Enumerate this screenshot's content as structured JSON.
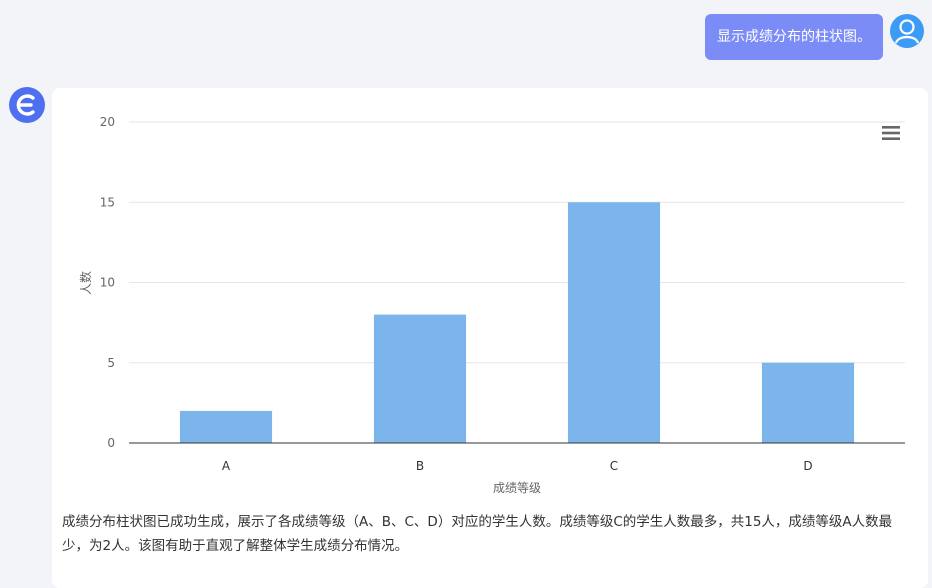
{
  "user_message": "显示成绩分布的柱状图。",
  "summary_text": "成绩分布柱状图已成功生成，展示了各成绩等级（A、B、C、D）对应的学生人数。成绩等级C的学生人数最多，共15人，成绩等级A人数最少，为2人。该图有助于直观了解整体学生成绩分布情况。",
  "colors": {
    "background": "#f3f4f8",
    "user_bubble": "#7b8cf7",
    "bar": "#7cb5ec",
    "bot_avatar": "#4f6ff1",
    "user_avatar": "#3b9bf5"
  },
  "icons": {
    "bot_avatar": "epsilon-logo-icon",
    "user_avatar": "user-avatar-icon",
    "chart_menu": "hamburger-menu-icon"
  },
  "chart_data": {
    "type": "bar",
    "title": "",
    "categories": [
      "A",
      "B",
      "C",
      "D"
    ],
    "values": [
      2,
      8,
      15,
      5
    ],
    "xlabel": "成绩等级",
    "ylabel": "人数",
    "ylim": [
      0,
      20
    ],
    "yticks": [
      0,
      5,
      10,
      15,
      20
    ],
    "grid": true,
    "legend": "none"
  }
}
